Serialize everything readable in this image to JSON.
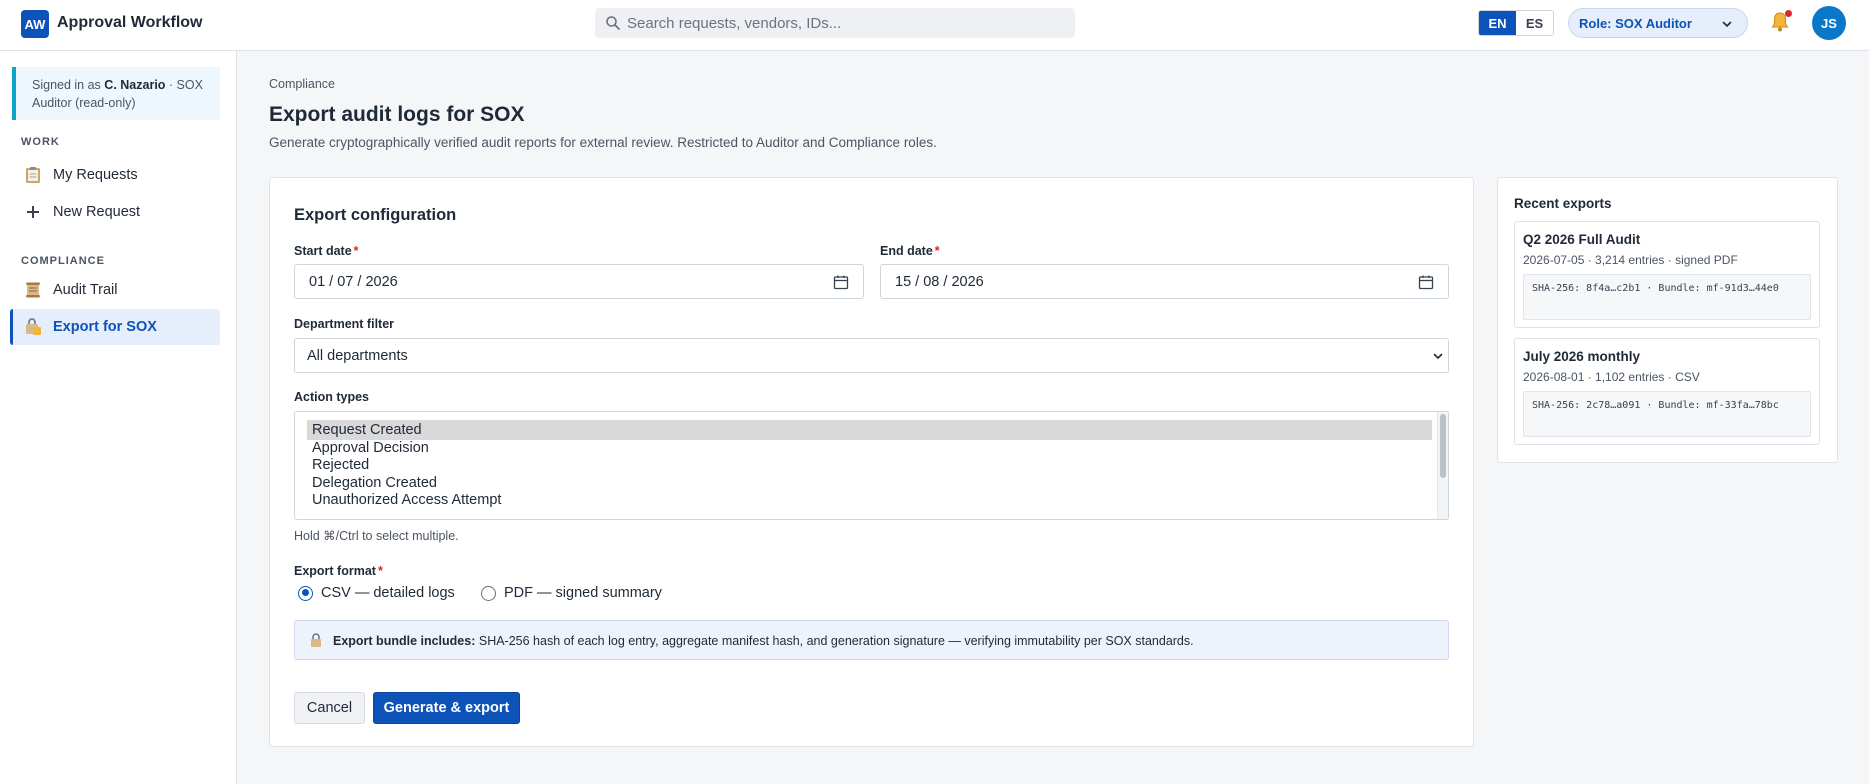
{
  "app": {
    "logo": "AW",
    "title": "Approval Workflow"
  },
  "search": {
    "placeholder": "Search requests, vendors, IDs...",
    "icon": "search-icon"
  },
  "languages": [
    {
      "code": "EN",
      "active": true
    },
    {
      "code": "ES",
      "active": false
    }
  ],
  "role": {
    "label": "Role:  SOX Auditor"
  },
  "notifications": {
    "icon": "bell-icon",
    "has_unread": true
  },
  "user": {
    "initials": "JS"
  },
  "sidebar": {
    "signed_in": {
      "prefix": "Signed in as",
      "name": "C. Nazario",
      "suffix": "· SOX Auditor (read-only)"
    },
    "sections": [
      {
        "label": "WORK",
        "items": [
          {
            "label": "My Requests",
            "icon": "clipboard-icon"
          },
          {
            "label": "New Request",
            "icon": "plus-icon"
          }
        ]
      },
      {
        "label": "COMPLIANCE",
        "items": [
          {
            "label": "Audit Trail",
            "icon": "scroll-icon"
          },
          {
            "label": "Export for SOX",
            "icon": "lock-icon",
            "active": true
          }
        ]
      }
    ]
  },
  "page": {
    "breadcrumb": "Compliance",
    "title": "Export audit logs for SOX",
    "description": "Generate cryptographically verified audit reports for external review. Restricted to Auditor and Compliance roles."
  },
  "form": {
    "title": "Export configuration",
    "start_date": {
      "label": "Start date",
      "required": "*",
      "day": "01",
      "month": "07",
      "year": "2026"
    },
    "end_date": {
      "label": "End date",
      "required": "*",
      "day": "15",
      "month": "08",
      "year": "2026"
    },
    "department": {
      "label": "Department filter",
      "value": "All departments"
    },
    "action_types": {
      "label": "Action types",
      "options": [
        {
          "label": "Request Created",
          "selected": true
        },
        {
          "label": "Approval Decision",
          "selected": false
        },
        {
          "label": "Rejected",
          "selected": false
        },
        {
          "label": "Delegation Created",
          "selected": false
        },
        {
          "label": "Unauthorized Access Attempt",
          "selected": false
        }
      ],
      "hint": "Hold ⌘/Ctrl to select multiple."
    },
    "export_format": {
      "label": "Export format",
      "required": "*",
      "options": [
        {
          "label": "CSV — detailed logs",
          "checked": true
        },
        {
          "label": "PDF — signed summary",
          "checked": false
        }
      ]
    },
    "bundle_info": {
      "bold": "Export bundle includes:",
      "text": "SHA-256 hash of each log entry, aggregate manifest hash, and generation signature — verifying immutability per SOX standards."
    },
    "cancel_label": "Cancel",
    "submit_label": "Generate & export"
  },
  "recent_exports": {
    "title": "Recent exports",
    "items": [
      {
        "name": "Q2 2026 Full Audit",
        "meta": "2026-07-05 · 3,214 entries · signed PDF",
        "hash": "SHA-256: 8f4a…c2b1 · Bundle: mf-91d3…44e0"
      },
      {
        "name": "July 2026 monthly",
        "meta": "2026-08-01 · 1,102 entries · CSV",
        "hash": "SHA-256: 2c78…a091 · Bundle: mf-33fa…78bc"
      }
    ]
  },
  "colors": {
    "primary": "#0c52b8",
    "required": "#dc2626",
    "accent": "#0ea5c6"
  }
}
